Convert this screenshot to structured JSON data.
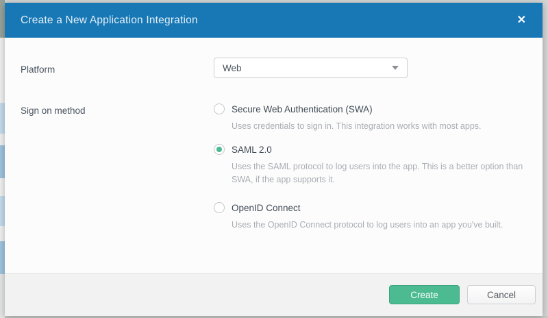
{
  "dialog": {
    "title": "Create a New Application Integration",
    "close_icon": "✕"
  },
  "form": {
    "platform": {
      "label": "Platform",
      "value": "Web"
    },
    "sign_on": {
      "label": "Sign on method",
      "options": [
        {
          "label": "Secure Web Authentication (SWA)",
          "description": "Uses credentials to sign in. This integration works with most apps.",
          "selected": false
        },
        {
          "label": "SAML 2.0",
          "description": "Uses the SAML protocol to log users into the app. This is a better option than SWA, if the app supports it.",
          "selected": true
        },
        {
          "label": "OpenID Connect",
          "description": "Uses the OpenID Connect protocol to log users into an app you've built.",
          "selected": false
        }
      ]
    }
  },
  "footer": {
    "create_label": "Create",
    "cancel_label": "Cancel"
  },
  "colors": {
    "header_blue": "#1878b5",
    "accent_green": "#4cbb92",
    "label_text": "#47525d",
    "description_text": "#a9aeb4",
    "footer_bg": "#f2f2f3"
  }
}
